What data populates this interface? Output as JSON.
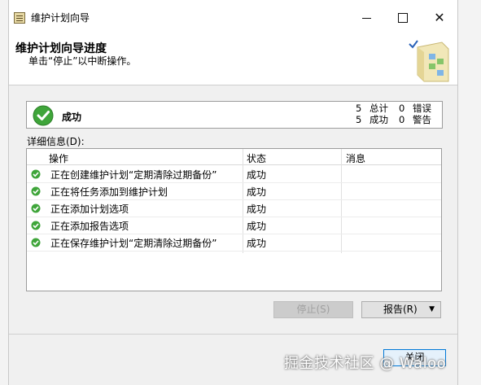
{
  "window": {
    "title": "维护计划向导"
  },
  "header": {
    "title": "维护计划向导进度",
    "subtitle": "单击“停止”以中断操作。"
  },
  "status": {
    "text": "成功",
    "counts": [
      {
        "value": "5",
        "label": "总计",
        "value2": "0",
        "label2": "错误"
      },
      {
        "value": "5",
        "label": "成功",
        "value2": "0",
        "label2": "警告"
      }
    ]
  },
  "details": {
    "label": "详细信息(D):",
    "columns": [
      "操作",
      "状态",
      "消息"
    ],
    "rows": [
      {
        "action": "正在创建维护计划“定期清除过期备份”",
        "status": "成功",
        "message": ""
      },
      {
        "action": "正在将任务添加到维护计划",
        "status": "成功",
        "message": ""
      },
      {
        "action": "正在添加计划选项",
        "status": "成功",
        "message": ""
      },
      {
        "action": "正在添加报告选项",
        "status": "成功",
        "message": ""
      },
      {
        "action": "正在保存维护计划“定期清除过期备份”",
        "status": "成功",
        "message": ""
      }
    ]
  },
  "buttons": {
    "stop": "停止(S)",
    "report": "报告(R)",
    "close": "关闭"
  },
  "watermark": "掘金技术社区 @ Waloo",
  "colors": {
    "success_green": "#3fa53a",
    "accent_blue": "#0078d7"
  },
  "icons": {
    "status": "success-check-icon",
    "row": "success-check-icon",
    "header": "wizard-graphic-icon"
  }
}
